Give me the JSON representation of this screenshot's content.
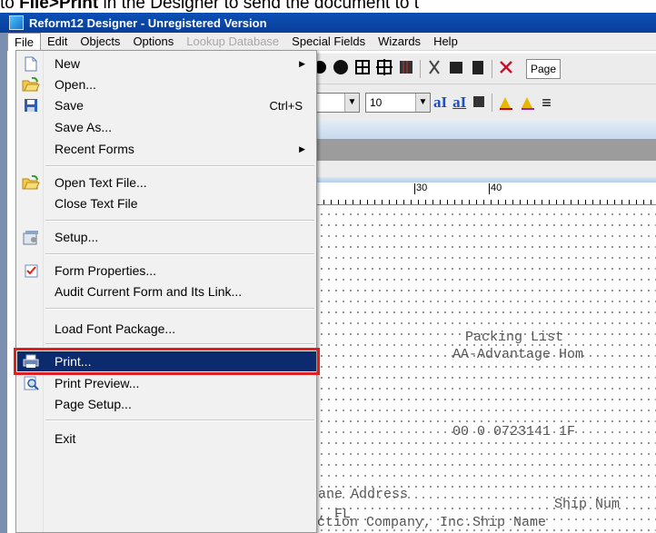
{
  "doc_sentence": {
    "prefix": "to ",
    "bold": "File>Print",
    "rest": " in the Designer to send the document to t"
  },
  "titlebar": {
    "title": "Reform12 Designer - Unregistered Version"
  },
  "menubar": {
    "items": [
      {
        "label": "File",
        "active": true
      },
      {
        "label": "Edit"
      },
      {
        "label": "Objects"
      },
      {
        "label": "Options"
      },
      {
        "label": "Lookup Database",
        "disabled": true
      },
      {
        "label": "Special Fields"
      },
      {
        "label": "Wizards"
      },
      {
        "label": "Help"
      }
    ]
  },
  "file_menu": {
    "items": [
      {
        "label": "New",
        "icon": "new-document-icon",
        "submenu": true
      },
      {
        "label": "Open...",
        "icon": "open-folder-icon"
      },
      {
        "label": "Save",
        "icon": "save-disk-icon",
        "shortcut": "Ctrl+S"
      },
      {
        "label": "Save As..."
      },
      {
        "label": "Recent Forms",
        "submenu": true
      },
      {
        "label": "Open Text File...",
        "icon": "open-folder-icon"
      },
      {
        "label": "Close Text File"
      },
      {
        "label": "Setup...",
        "icon": "setup-icon"
      },
      {
        "label": "Form Properties...",
        "icon": "checkbox-icon"
      },
      {
        "label": "Audit Current Form and Its Link..."
      },
      {
        "label": "Load Font Package..."
      },
      {
        "label": "Print...",
        "icon": "printer-icon",
        "highlighted": true
      },
      {
        "label": "Print Preview...",
        "icon": "print-preview-icon"
      },
      {
        "label": "Page Setup..."
      },
      {
        "label": "Exit"
      }
    ]
  },
  "toolbar": {
    "page_button": "Page",
    "font_size": "10"
  },
  "ruler": {
    "marks": [
      "30",
      "40"
    ]
  },
  "document_lines": [
    "Packing List",
    "AA-Advantage Hom",
    "00 0 0723141   1F",
    "Ship Num",
    "ction Company, Inc.Ship Name",
    "ane            Address",
    ", FL"
  ],
  "colors": {
    "highlight": "#0c2a6e",
    "callout": "#e02020",
    "titlebar": "#0b4fb5"
  }
}
